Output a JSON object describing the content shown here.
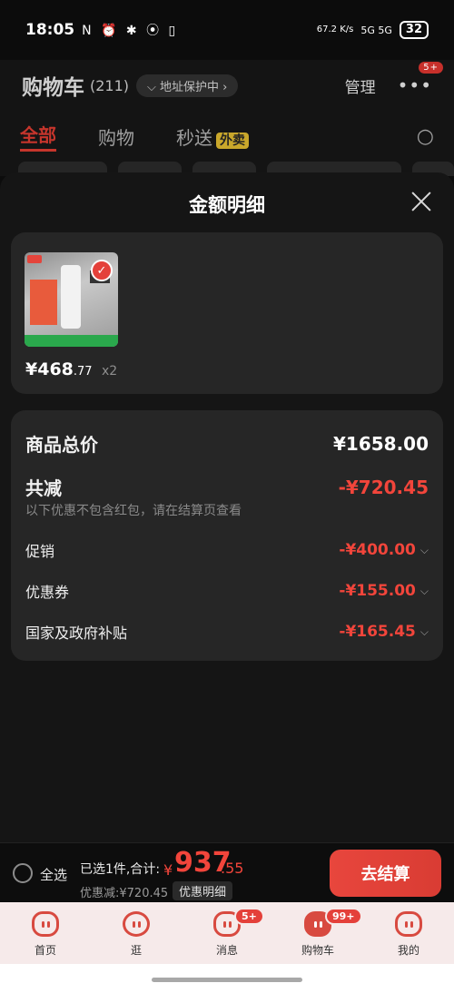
{
  "status_bar": {
    "time": "18:05",
    "icons": "N ⏰ ✱ ⦿ ▯",
    "net_speed": "67.2 K/s",
    "signal": "5G 5G",
    "battery": "32"
  },
  "cart_header": {
    "title": "购物车",
    "count": "(211)",
    "address_protect": "⌵ 地址保护中 ›",
    "manage": "管理",
    "more_badge": "5+"
  },
  "tabs": [
    {
      "label": "全部",
      "active": true
    },
    {
      "label": "购物"
    },
    {
      "label": "秒送",
      "tag": "外卖"
    }
  ],
  "sheet": {
    "title": "金额明细",
    "item": {
      "price_main": "¥468",
      "price_decimal": ".77",
      "quantity": "x2"
    },
    "summary": {
      "total_label": "商品总价",
      "total_value": "¥1658.00",
      "reduce_label": "共减",
      "reduce_value": "-¥720.45",
      "note": "以下优惠不包含红包，请在结算页查看",
      "lines": [
        {
          "label": "促销",
          "value": "-¥400.00"
        },
        {
          "label": "优惠券",
          "value": "-¥155.00"
        },
        {
          "label": "国家及政府补贴",
          "value": "-¥165.45"
        }
      ]
    }
  },
  "checkout": {
    "select_all": "全选",
    "chosen": "已选1件,合计:",
    "currency": "¥",
    "amount_int": "937",
    "amount_dec": ".55",
    "discount": "优惠减:¥720.45",
    "detail": "优惠明细",
    "pay": "去结算"
  },
  "nav": [
    {
      "label": "首页"
    },
    {
      "label": "逛"
    },
    {
      "label": "消息",
      "badge": "5+"
    },
    {
      "label": "购物车",
      "badge": "99+",
      "active": true
    },
    {
      "label": "我的"
    }
  ],
  "colors": {
    "accent": "#f2453b",
    "background": "#0c0c0c",
    "card": "#262626"
  }
}
